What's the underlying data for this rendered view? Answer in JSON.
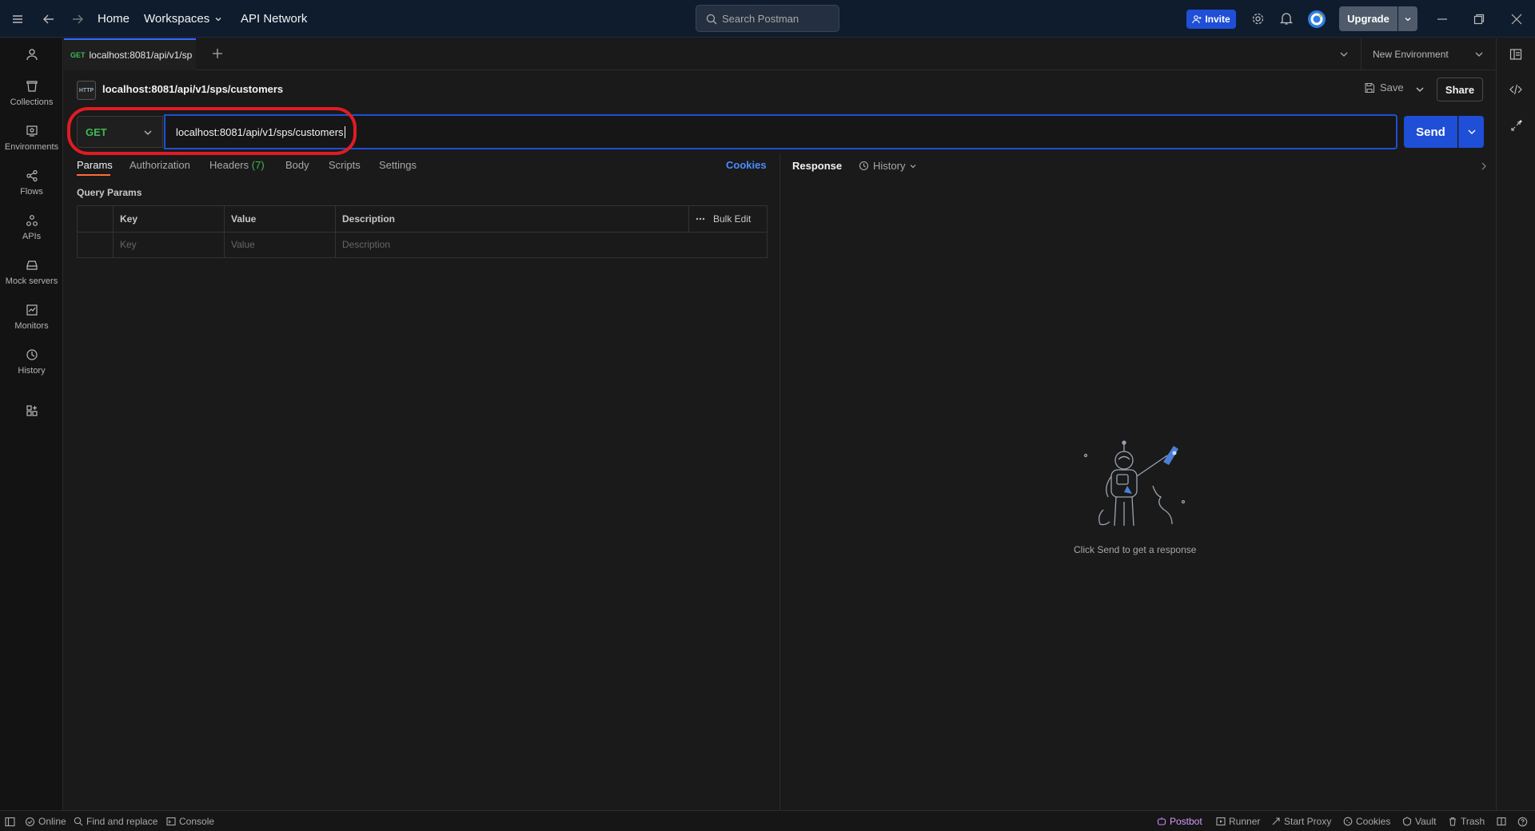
{
  "titlebar": {
    "home": "Home",
    "workspaces": "Workspaces",
    "api_network": "API Network",
    "search_placeholder": "Search Postman",
    "invite": "Invite",
    "upgrade": "Upgrade"
  },
  "sidebar": {
    "items": [
      {
        "label": "Collections",
        "icon": "collections-icon"
      },
      {
        "label": "Environments",
        "icon": "environments-icon"
      },
      {
        "label": "Flows",
        "icon": "flows-icon"
      },
      {
        "label": "APIs",
        "icon": "apis-icon"
      },
      {
        "label": "Mock servers",
        "icon": "mock-servers-icon"
      },
      {
        "label": "Monitors",
        "icon": "monitors-icon"
      },
      {
        "label": "History",
        "icon": "history-icon"
      }
    ]
  },
  "tab": {
    "method": "GET",
    "title": "localhost:8081/api/v1/sp"
  },
  "environment": {
    "selected": "New Environment"
  },
  "request": {
    "badge": "HTTP",
    "name": "localhost:8081/api/v1/sps/customers",
    "save": "Save",
    "share": "Share",
    "method": "GET",
    "url": "localhost:8081/api/v1/sps/customers",
    "send": "Send"
  },
  "tabs": {
    "params": "Params",
    "authorization": "Authorization",
    "headers": "Headers",
    "headers_count": "(7)",
    "body": "Body",
    "scripts": "Scripts",
    "settings": "Settings",
    "cookies": "Cookies"
  },
  "params": {
    "section_title": "Query Params",
    "headers": {
      "key": "Key",
      "value": "Value",
      "description": "Description"
    },
    "bulk_edit": "Bulk Edit",
    "placeholders": {
      "key": "Key",
      "value": "Value",
      "description": "Description"
    }
  },
  "response": {
    "title": "Response",
    "history": "History",
    "empty_text": "Click Send to get a response"
  },
  "statusbar": {
    "online": "Online",
    "find_replace": "Find and replace",
    "console": "Console",
    "postbot": "Postbot",
    "runner": "Runner",
    "start_proxy": "Start Proxy",
    "cookies": "Cookies",
    "vault": "Vault",
    "trash": "Trash"
  },
  "colors": {
    "accent_blue": "#1f4fd6",
    "get_green": "#3fb950",
    "orange": "#ff6c37",
    "highlight_red": "#e01b24"
  }
}
